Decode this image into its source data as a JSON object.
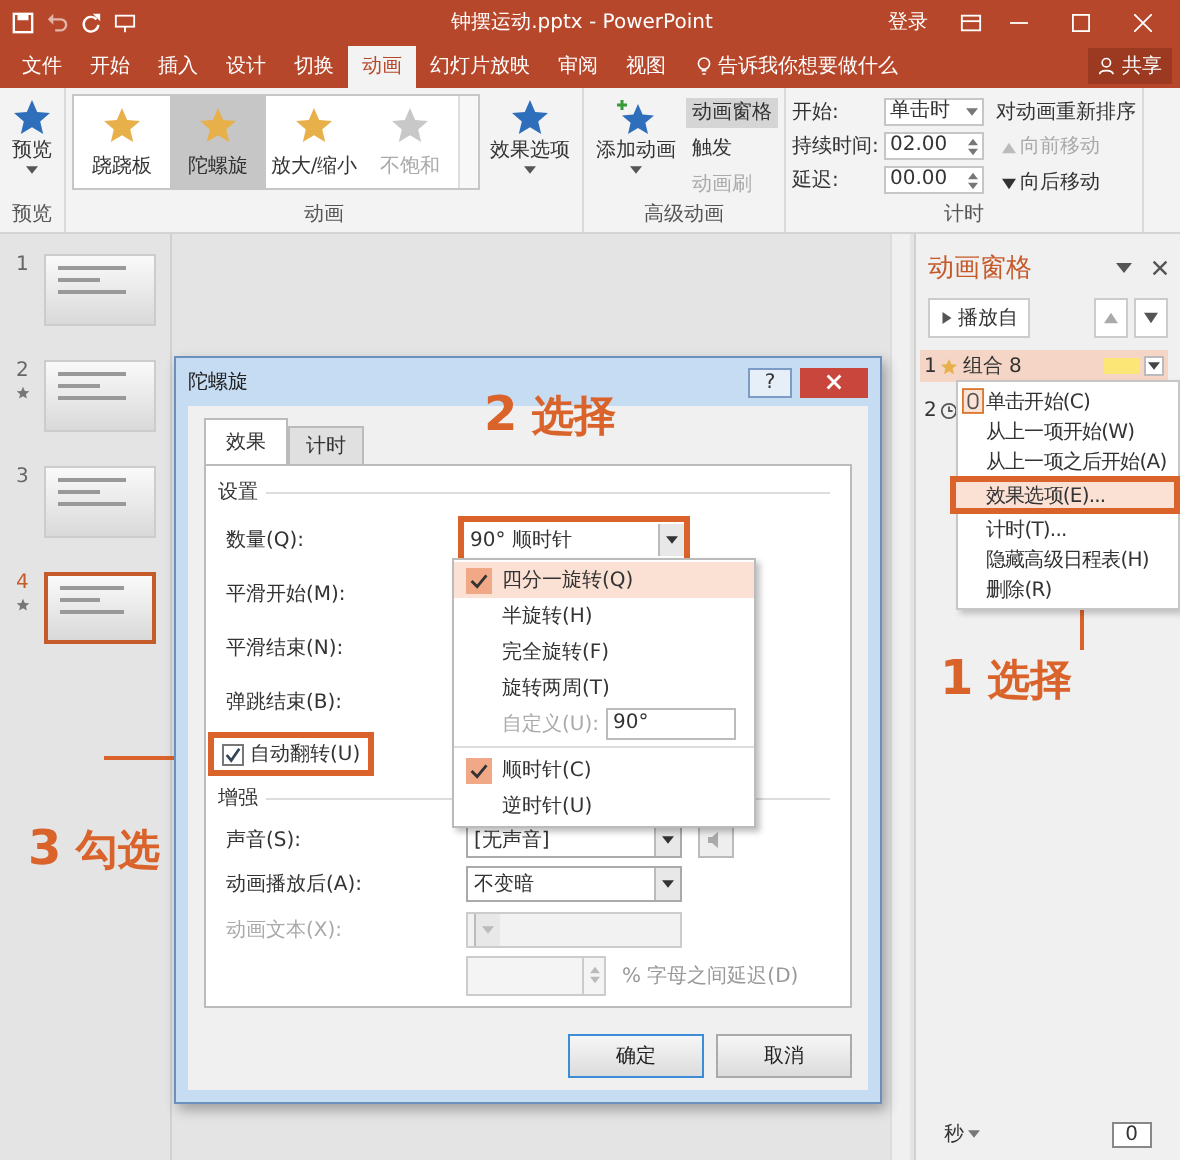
{
  "title_bar": {
    "title": "钟摆运动.pptx - PowerPoint",
    "login": "登录"
  },
  "tabs": [
    {
      "label": "文件",
      "selected": false
    },
    {
      "label": "开始",
      "selected": false
    },
    {
      "label": "插入",
      "selected": false
    },
    {
      "label": "设计",
      "selected": false
    },
    {
      "label": "切换",
      "selected": false
    },
    {
      "label": "动画",
      "selected": true
    },
    {
      "label": "幻灯片放映",
      "selected": false
    },
    {
      "label": "审阅",
      "selected": false
    },
    {
      "label": "视图",
      "selected": false
    }
  ],
  "tell_me": "告诉我你想要做什么",
  "share": "共享",
  "ribbon": {
    "preview": "预览",
    "preview_group": "预览",
    "gallery": [
      {
        "label": "跷跷板",
        "selected": false,
        "disabled": false
      },
      {
        "label": "陀螺旋",
        "selected": true,
        "disabled": false
      },
      {
        "label": "放大/缩小",
        "selected": false,
        "disabled": false
      },
      {
        "label": "不饱和",
        "selected": false,
        "disabled": true
      }
    ],
    "effect_options": "效果选项",
    "animation_group": "动画",
    "add_animation": "添加动画",
    "advanced": [
      {
        "label": "动画窗格",
        "selected": true,
        "disabled": false
      },
      {
        "label": "触发",
        "selected": false,
        "disabled": false
      },
      {
        "label": "动画刷",
        "selected": false,
        "disabled": true
      }
    ],
    "advanced_group": "高级动画",
    "timing": [
      {
        "label": "开始:",
        "value": "单击时",
        "kind": "dropdown"
      },
      {
        "label": "持续时间:",
        "value": "02.00",
        "kind": "spinner"
      },
      {
        "label": "延迟:",
        "value": "00.00",
        "kind": "spinner"
      }
    ],
    "reorder": "对动画重新排序",
    "move_earlier": {
      "label": "向前移动",
      "disabled": true
    },
    "move_later": {
      "label": "向后移动",
      "disabled": false
    },
    "timing_group": "计时"
  },
  "slides": [
    {
      "number": "1",
      "animated": false,
      "selected": false
    },
    {
      "number": "2",
      "animated": true,
      "selected": false
    },
    {
      "number": "3",
      "animated": false,
      "selected": false
    },
    {
      "number": "4",
      "animated": true,
      "selected": true
    }
  ],
  "pane": {
    "title": "动画窗格",
    "play": "播放自",
    "items": [
      {
        "number": "1",
        "name": "组合 8",
        "kind": "click",
        "selected": true
      },
      {
        "number": "2",
        "kind": "after",
        "selected": false
      }
    ],
    "seconds": "秒",
    "zoom": "0"
  },
  "context_menu": [
    {
      "label": "单击开始(C)",
      "checked": true,
      "highlighted": false
    },
    {
      "label": "从上一项开始(W)",
      "checked": false,
      "highlighted": false
    },
    {
      "label": "从上一项之后开始(A)",
      "checked": false,
      "highlighted": false
    },
    {
      "label": "效果选项(E)...",
      "checked": false,
      "highlighted": true
    },
    {
      "label": "计时(T)...",
      "checked": false,
      "highlighted": false
    },
    {
      "label": "隐藏高级日程表(H)",
      "checked": false,
      "highlighted": false
    },
    {
      "label": "删除(R)",
      "checked": false,
      "highlighted": false
    }
  ],
  "dialog": {
    "title": "陀螺旋",
    "help": "?",
    "tabs": [
      {
        "label": "效果",
        "selected": true
      },
      {
        "label": "计时",
        "selected": false
      }
    ],
    "settings_header": "设置",
    "amount_label": "数量(Q):",
    "amount_value": "90° 顺时针",
    "labels": [
      "平滑开始(M):",
      "平滑结束(N):",
      "弹跳结束(B):"
    ],
    "auto_reverse": {
      "label": "自动翻转(U)",
      "checked": true
    },
    "enhance_header": "增强",
    "enhance": [
      {
        "label": "声音(S):",
        "value": "[无声音]",
        "disabled": false
      },
      {
        "label": "动画播放后(A):",
        "value": "不变暗",
        "disabled": false
      },
      {
        "label": "动画文本(X):",
        "disabled": true
      }
    ],
    "delay_label": "% 字母之间延迟(D)",
    "ok": "确定",
    "cancel": "取消",
    "dropdown": [
      {
        "kind": "option",
        "label": "四分一旋转(Q)",
        "checked": true,
        "highlighted": true
      },
      {
        "kind": "option",
        "label": "半旋转(H)",
        "checked": false,
        "highlighted": false
      },
      {
        "kind": "option",
        "label": "完全旋转(F)",
        "checked": false,
        "highlighted": false
      },
      {
        "kind": "option",
        "label": "旋转两周(T)",
        "checked": false,
        "highlighted": false
      },
      {
        "kind": "custom",
        "label": "自定义(U):",
        "value": "90°"
      },
      {
        "kind": "separator"
      },
      {
        "kind": "option",
        "label": "顺时针(C)",
        "checked": true,
        "highlighted": false
      },
      {
        "kind": "option",
        "label": "逆时针(U)",
        "checked": false,
        "highlighted": false
      }
    ]
  },
  "annotations": [
    {
      "number": "2",
      "text": "选择",
      "kind": "top"
    },
    {
      "number": "3",
      "text": "勾选",
      "kind": "left"
    },
    {
      "number": "1",
      "text": "选择",
      "kind": "right"
    }
  ]
}
